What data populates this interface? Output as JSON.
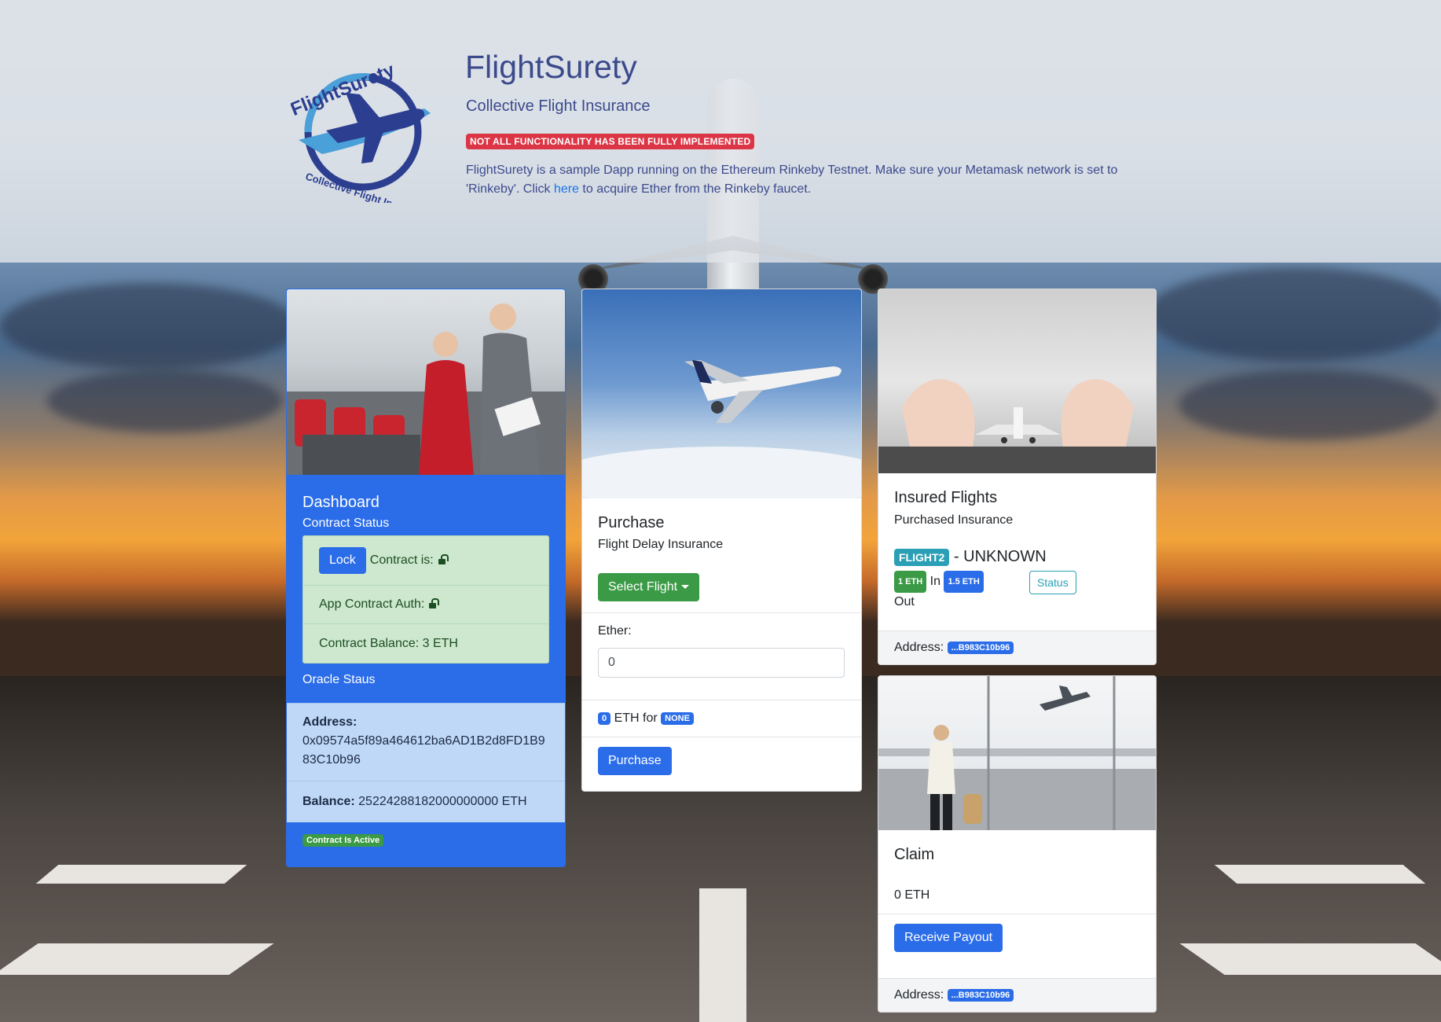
{
  "header": {
    "title": "FlightSurety",
    "subtitle": "Collective Flight Insurance",
    "warning_badge": "NOT ALL FUNCTIONALITY HAS BEEN FULLY IMPLEMENTED",
    "intro_before_link": "FlightSurety is a sample Dapp running on the Ethereum Rinkeby Testnet. Make sure your Metamask network is set to 'Rinkeby'. Click ",
    "intro_link": "here",
    "intro_after_link": " to acquire Ether from the Rinkeby faucet.",
    "logo_text_top": "FlightSurety",
    "logo_text_bottom": "Collective Flight Insurance"
  },
  "dashboard": {
    "title": "Dashboard",
    "contract_status_label": "Contract Status",
    "lock_button": "Lock",
    "contract_is_label": "Contract is:",
    "app_contract_auth_label": "App Contract Auth:",
    "contract_balance": "Contract Balance: 3 ETH",
    "oracle_status_label": "Oracle Staus",
    "address_label": "Address:",
    "address_value": "0x09574a5f89a464612ba6AD1B2d8FD1B983C10b96",
    "balance_label": "Balance:",
    "balance_value": "25224288182000000000 ETH",
    "active_badge": "Contract Is Active"
  },
  "purchase": {
    "title": "Purchase",
    "subtitle": "Flight Delay Insurance",
    "select_flight_button": "Select Flight",
    "ether_label": "Ether:",
    "ether_input_value": "0",
    "amount_badge": "0",
    "eth_for_text": "ETH for",
    "flight_badge": "NONE",
    "purchase_button": "Purchase"
  },
  "insured": {
    "title": "Insured Flights",
    "subtitle": "Purchased Insurance",
    "flight_badge": "FLIGHT2",
    "flight_status": "- UNKNOWN",
    "in_badge": "1 ETH",
    "in_label": "In",
    "out_badge": "1.5 ETH",
    "out_label": "Out",
    "status_button": "Status",
    "address_label": "Address:",
    "address_badge": "...B983C10b96"
  },
  "claim": {
    "title": "Claim",
    "amount": "0 ETH",
    "payout_button": "Receive Payout",
    "address_label": "Address:",
    "address_badge": "...B983C10b96"
  }
}
